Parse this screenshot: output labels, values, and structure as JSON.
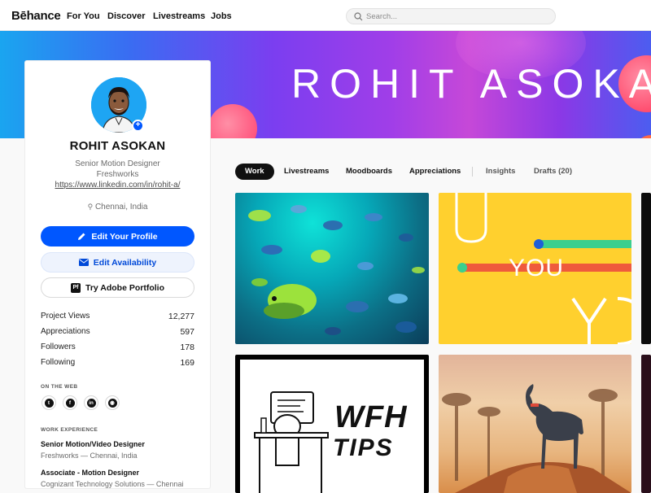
{
  "nav": {
    "logo": "Bēhance",
    "links": [
      "For You",
      "Discover",
      "Livestreams",
      "Jobs"
    ],
    "search_placeholder": "Search..."
  },
  "banner": {
    "text": "ROHIT ASOKAN"
  },
  "profile": {
    "name": "ROHIT ASOKAN",
    "title": "Senior Motion Designer",
    "company": "Freshworks",
    "link": "https://www.linkedin.com/in/rohit-a/",
    "location": "Chennai, India",
    "buttons": {
      "edit_profile": "Edit Your Profile",
      "edit_availability": "Edit Availability",
      "portfolio": "Try Adobe Portfolio",
      "portfolio_icon": "Pf"
    },
    "stats": [
      {
        "label": "Project Views",
        "value": "12,277"
      },
      {
        "label": "Appreciations",
        "value": "597"
      },
      {
        "label": "Followers",
        "value": "178"
      },
      {
        "label": "Following",
        "value": "169"
      }
    ],
    "on_the_web_heading": "ON THE WEB",
    "social_icons": [
      "tumblr-icon",
      "facebook-icon",
      "linkedin-icon",
      "instagram-icon"
    ],
    "work_experience_heading": "WORK EXPERIENCE",
    "jobs": [
      {
        "title": "Senior Motion/Video Designer",
        "sub": "Freshworks — Chennai, India"
      },
      {
        "title": "Associate - Motion Designer",
        "sub": "Cognizant Technology Solutions — Chennai"
      }
    ]
  },
  "tabs": [
    {
      "label": "Work",
      "active": true
    },
    {
      "label": "Livestreams"
    },
    {
      "label": "Moodboards"
    },
    {
      "label": "Appreciations"
    },
    {
      "label": "Insights",
      "muted": true
    },
    {
      "label": "Drafts (20)",
      "muted": true
    }
  ],
  "projects": {
    "you_text": "YOU",
    "wfh_line1": "WFH",
    "wfh_line2": "TIPS"
  },
  "colors": {
    "accent": "#0057ff",
    "banner_start": "#1aa5f0",
    "banner_mid": "#a03ee8",
    "project_yellow": "#ffd02e"
  }
}
